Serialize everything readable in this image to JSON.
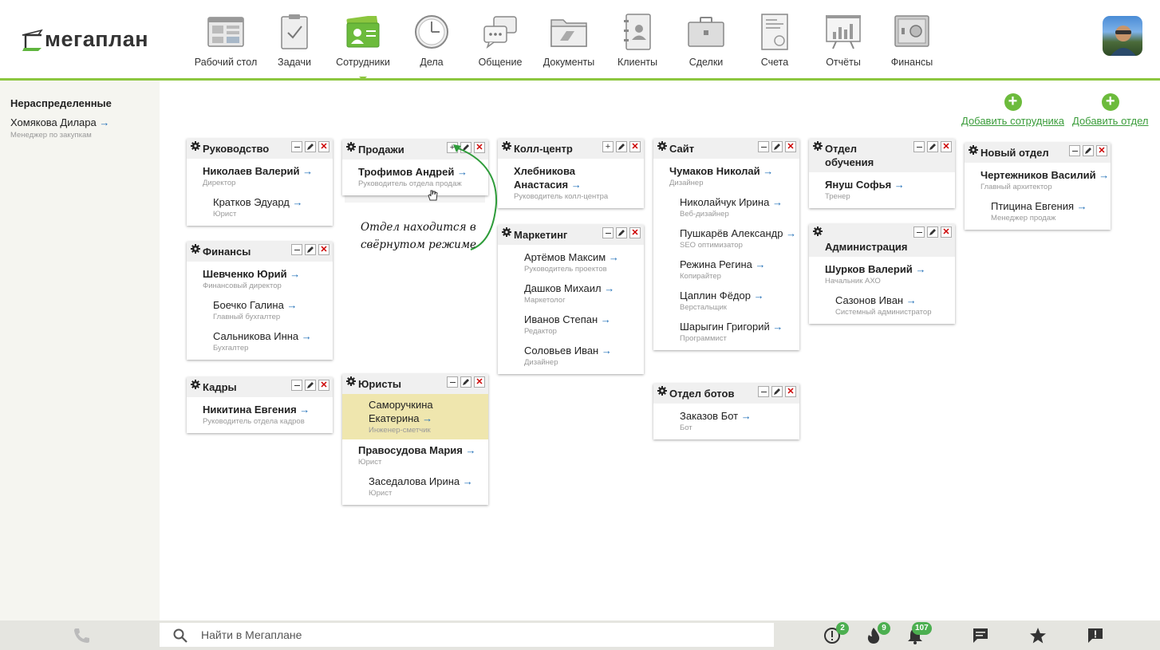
{
  "app": {
    "logo_text": "мегаплан"
  },
  "nav": [
    {
      "label": "Рабочий стол",
      "icon": "desktop-icon"
    },
    {
      "label": "Задачи",
      "icon": "tasks-icon"
    },
    {
      "label": "Сотрудники",
      "icon": "employees-icon",
      "active": true
    },
    {
      "label": "Дела",
      "icon": "clock-icon"
    },
    {
      "label": "Общение",
      "icon": "chat-icon"
    },
    {
      "label": "Документы",
      "icon": "folder-icon"
    },
    {
      "label": "Клиенты",
      "icon": "contacts-icon"
    },
    {
      "label": "Сделки",
      "icon": "briefcase-icon"
    },
    {
      "label": "Счета",
      "icon": "invoice-icon"
    },
    {
      "label": "Отчёты",
      "icon": "reports-icon"
    },
    {
      "label": "Финансы",
      "icon": "safe-icon"
    }
  ],
  "sidebar": {
    "title": "Нераспределенные",
    "employee": {
      "name": "Хомякова Дилара",
      "role": "Менеджер по закупкам"
    }
  },
  "actions": {
    "add_employee": "Добавить сотрудника",
    "add_department": "Добавить отдел"
  },
  "annotation": {
    "line1": "Отдел находится в",
    "line2": "свёрнутом режиме"
  },
  "arrow": "→",
  "departments": {
    "rukovodstvo": {
      "title": "Руководство",
      "employees": [
        {
          "name": "Николаев Валерий",
          "role": "Директор"
        },
        {
          "name": "Кратков Эдуард",
          "role": "Юрист"
        }
      ]
    },
    "finansy": {
      "title": "Финансы",
      "employees": [
        {
          "name": "Шевченко Юрий",
          "role": "Финансовый директор"
        },
        {
          "name": "Боечко Галина",
          "role": "Главный бухгалтер"
        },
        {
          "name": "Сальникова Инна",
          "role": "Бухгалтер"
        }
      ]
    },
    "kadry": {
      "title": "Кадры",
      "employees": [
        {
          "name": "Никитина Евгения",
          "role": "Руководитель отдела кадров"
        }
      ]
    },
    "prodazhi": {
      "title": "Продажи",
      "employees": [
        {
          "name": "Трофимов Андрей",
          "role": "Руководитель отдела продаж"
        }
      ]
    },
    "yuristy": {
      "title": "Юристы",
      "employees": [
        {
          "name": "Саморучкина Екатерина",
          "role": "Инженер-сметчик"
        },
        {
          "name": "Правосудова Мария",
          "role": "Юрист"
        },
        {
          "name": "Заседалова Ирина",
          "role": "Юрист"
        }
      ]
    },
    "kollcentr": {
      "title": "Колл-центр",
      "employees": [
        {
          "name": "Хлебникова Анастасия",
          "role": "Руководитель колл-центра"
        }
      ]
    },
    "marketing": {
      "title": "Маркетинг",
      "employees": [
        {
          "name": "Артёмов Максим",
          "role": "Руководитель проектов"
        },
        {
          "name": "Дашков Михаил",
          "role": "Маркетолог"
        },
        {
          "name": "Иванов Степан",
          "role": "Редактор"
        },
        {
          "name": "Соловьев Иван",
          "role": "Дизайнер"
        }
      ]
    },
    "sait": {
      "title": "Сайт",
      "employees": [
        {
          "name": "Чумаков Николай",
          "role": "Дизайнер"
        },
        {
          "name": "Николайчук Ирина",
          "role": "Веб-дизайнер"
        },
        {
          "name": "Пушкарёв Александр",
          "role": "SEO оптимизатор"
        },
        {
          "name": "Режина Регина",
          "role": "Копирайтер"
        },
        {
          "name": "Цаплин Фёдор",
          "role": "Верстальщик"
        },
        {
          "name": "Шарыгин Григорий",
          "role": "Программист"
        }
      ]
    },
    "boty": {
      "title": "Отдел ботов",
      "employees": [
        {
          "name": "Заказов Бот",
          "role": "Бот"
        }
      ]
    },
    "obuchenie": {
      "title": "Отдел обучения",
      "employees": [
        {
          "name": "Януш Софья",
          "role": "Тренер"
        }
      ]
    },
    "admin": {
      "title": "Администрация",
      "employees": [
        {
          "name": "Шурков Валерий",
          "role": "Начальник АХО"
        },
        {
          "name": "Сазонов Иван",
          "role": "Системный администратор"
        }
      ]
    },
    "novy": {
      "title": "Новый отдел",
      "employees": [
        {
          "name": "Чертежников Василий",
          "role": "Главный архитектор"
        },
        {
          "name": "Птицина Евгения",
          "role": "Менеджер продаж"
        }
      ]
    }
  },
  "bottombar": {
    "search_placeholder": "Найти в Мегаплане",
    "badges": {
      "alerts": "2",
      "hot": "9",
      "notifications": "107"
    }
  },
  "colors": {
    "accent": "#8cc63f",
    "link": "#3a9c3a",
    "highlight": "#efe6ae",
    "close": "#cc0000"
  }
}
